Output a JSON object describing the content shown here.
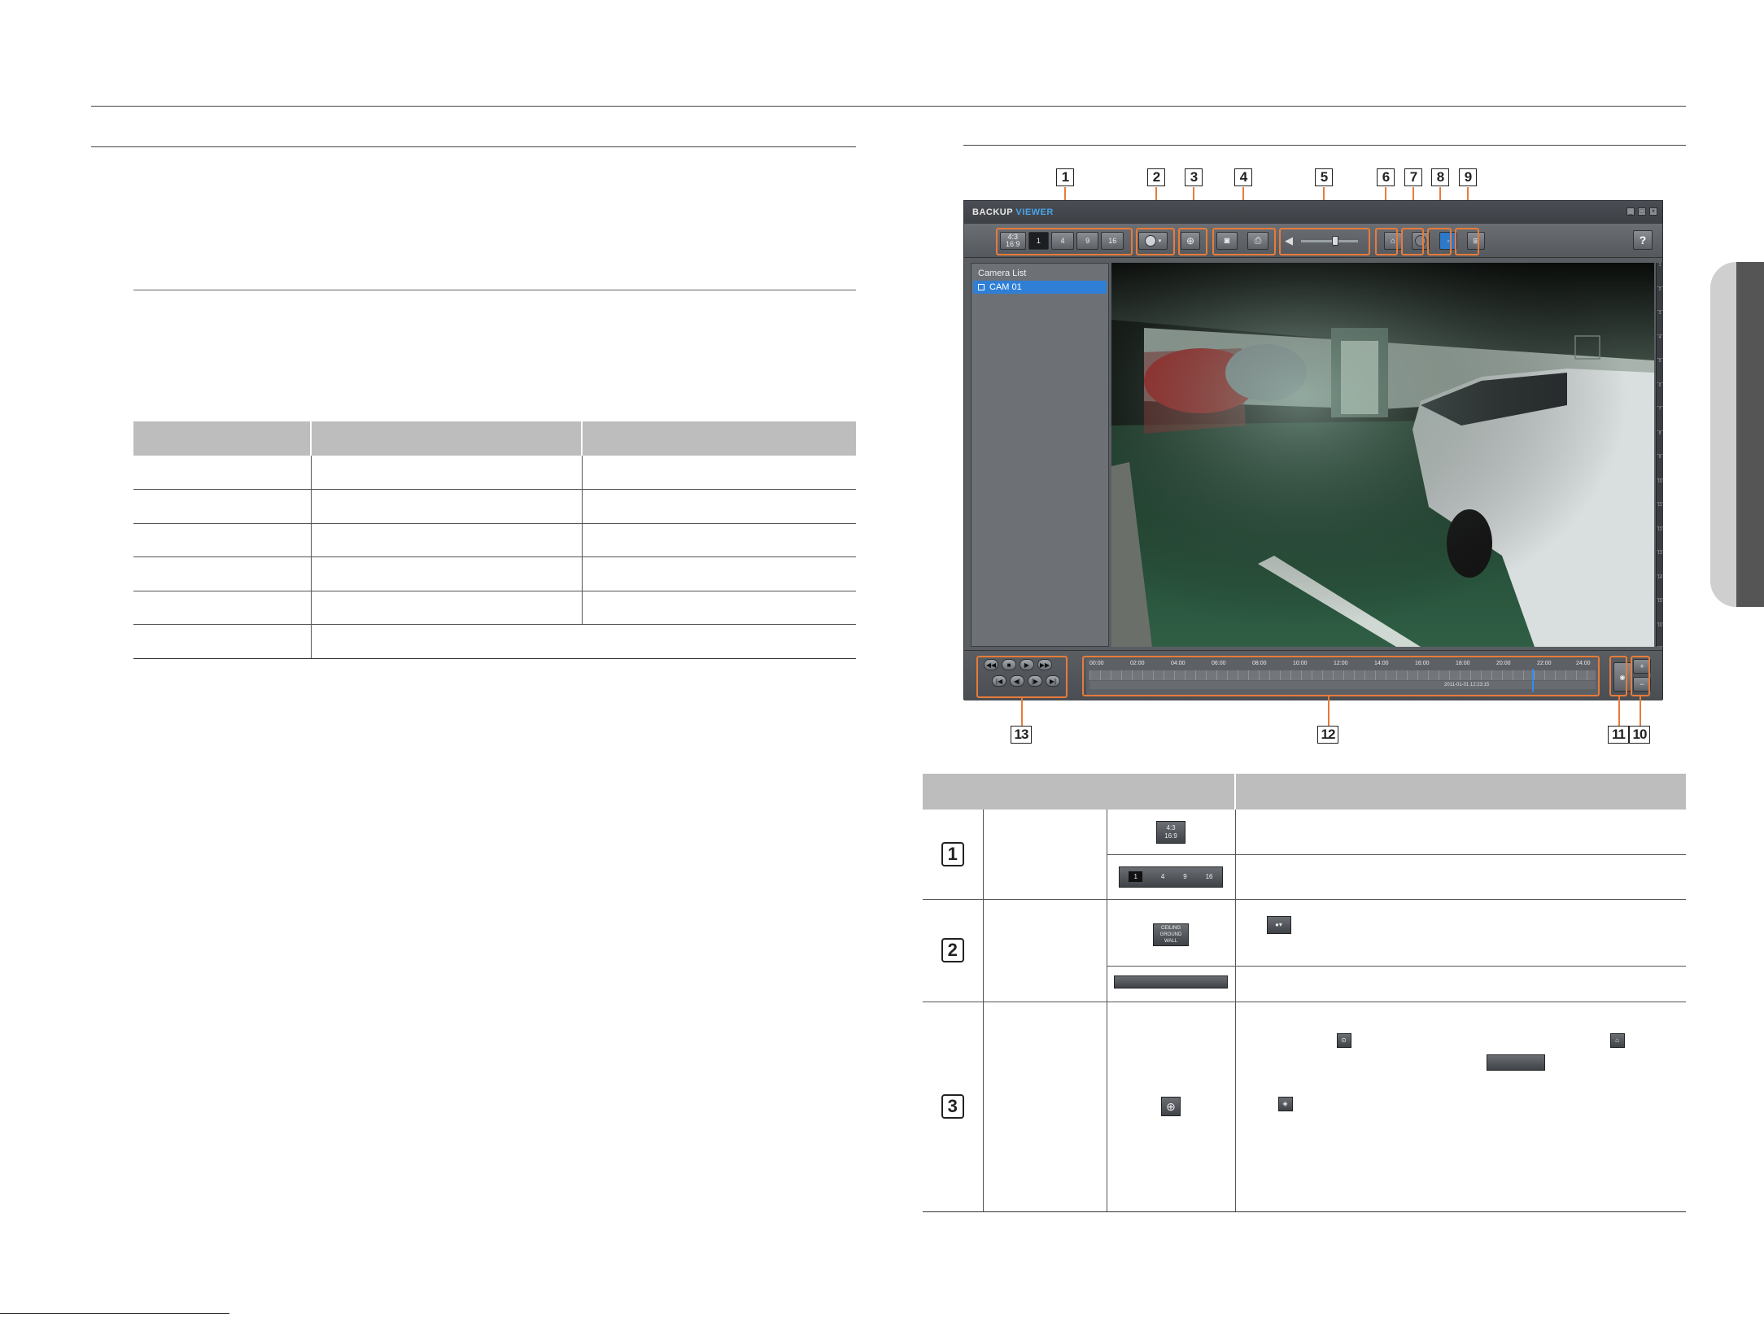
{
  "app": {
    "title_main": "BACKUP",
    "title_accent": "VIEWER",
    "win_min": "_",
    "win_max": "□",
    "win_close": "×",
    "help": "?",
    "aspect_top": "4:3",
    "aspect_bottom": "16:9",
    "split_1": "1",
    "split_4": "4",
    "split_9": "9",
    "split_16": "16",
    "camera_list_title": "Camera List",
    "camera_item": "CAM 01",
    "timeline_labels": [
      "00:00",
      "02:00",
      "04:00",
      "06:00",
      "08:00",
      "10:00",
      "12:00",
      "14:00",
      "16:00",
      "18:00",
      "20:00",
      "22:00",
      "24:00"
    ],
    "timeline_date": "2011-01-01 12:23:15",
    "ruler_numbers": [
      "1",
      "2",
      "3",
      "4",
      "5",
      "6",
      "7",
      "8",
      "9",
      "10",
      "11",
      "12",
      "13",
      "14",
      "15",
      "16"
    ],
    "zoom_in": "+",
    "zoom_out": "−"
  },
  "callouts": [
    "1",
    "2",
    "3",
    "4",
    "5",
    "6",
    "7",
    "8",
    "9",
    "10",
    "11",
    "12",
    "13"
  ],
  "table_rows": [
    {
      "num": "1"
    },
    {
      "num": "2"
    },
    {
      "num": "3"
    }
  ],
  "icons": {
    "aspect_ratio": "aspect-ratio-icon",
    "split_screen": "split-screen-icon",
    "dewarping": "dewarp-icon",
    "zoom": "zoom-icon",
    "capture": "camera-icon",
    "print": "print-icon",
    "audio": "speaker-icon"
  },
  "mini_mount": [
    "CEILING",
    "GROUND",
    "WALL"
  ],
  "colors": {
    "accent_orange": "#e77b3a",
    "selection_blue": "#2f7fd6",
    "header_gray": "#bdbdbd"
  }
}
